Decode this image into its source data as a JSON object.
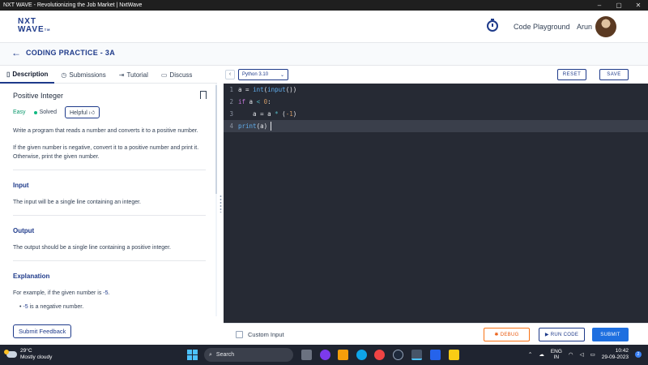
{
  "window": {
    "title": "NXT WAVE - Revolutionizing the Job Market | NxtWave",
    "minimize": "–",
    "maximize": "▢",
    "close": "✕"
  },
  "header": {
    "logo_line1": "NXT",
    "logo_line2": "WAVE",
    "logo_tm": "TM",
    "playground_label": "Code Playground",
    "username": "Arun"
  },
  "back_row": {
    "title": "CODING PRACTICE - 3A"
  },
  "tabs": [
    {
      "label": "Description",
      "icon": "document-icon"
    },
    {
      "label": "Submissions",
      "icon": "clock-icon"
    },
    {
      "label": "Tutorial",
      "icon": "tutorial-icon"
    },
    {
      "label": "Discuss",
      "icon": "chat-icon"
    }
  ],
  "problem": {
    "title": "Positive Integer",
    "difficulty": "Easy",
    "status": "Solved",
    "helpful_label": "Helpful",
    "description_1": "Write a program that reads a number and converts it to a positive number.",
    "description_2": "If the given number is negative, convert it to a positive number and print it. Otherwise, print the given number.",
    "input_heading": "Input",
    "input_text": "The input will be a single line containing an integer.",
    "output_heading": "Output",
    "output_text": "The output should be a single line containing a positive integer.",
    "explanation_heading": "Explanation",
    "explanation_text": "For example, if the given number is",
    "explanation_value": "-5",
    "explanation_bullet_value": "-5",
    "explanation_bullet_text": "is a negative number."
  },
  "left_footer": {
    "feedback_label": "Submit Feedback"
  },
  "editor_toolbar": {
    "collapse_symbol": "‹",
    "language": "Python 3.10",
    "reset_label": "RESET",
    "save_label": "SAVE"
  },
  "editor": {
    "line_numbers": [
      "1",
      "2",
      "3",
      "4"
    ]
  },
  "editor_footer": {
    "custom_input_label": "Custom Input",
    "debug_label": "DEBUG",
    "run_label": "RUN CODE",
    "submit_label": "SUBMIT"
  },
  "taskbar": {
    "temperature": "29°C",
    "weather": "Mostly cloudy",
    "search_placeholder": "Search",
    "lang_line1": "ENG",
    "lang_line2": "IN",
    "time": "10:42",
    "date": "29-09-2023",
    "notification_count": "2"
  }
}
